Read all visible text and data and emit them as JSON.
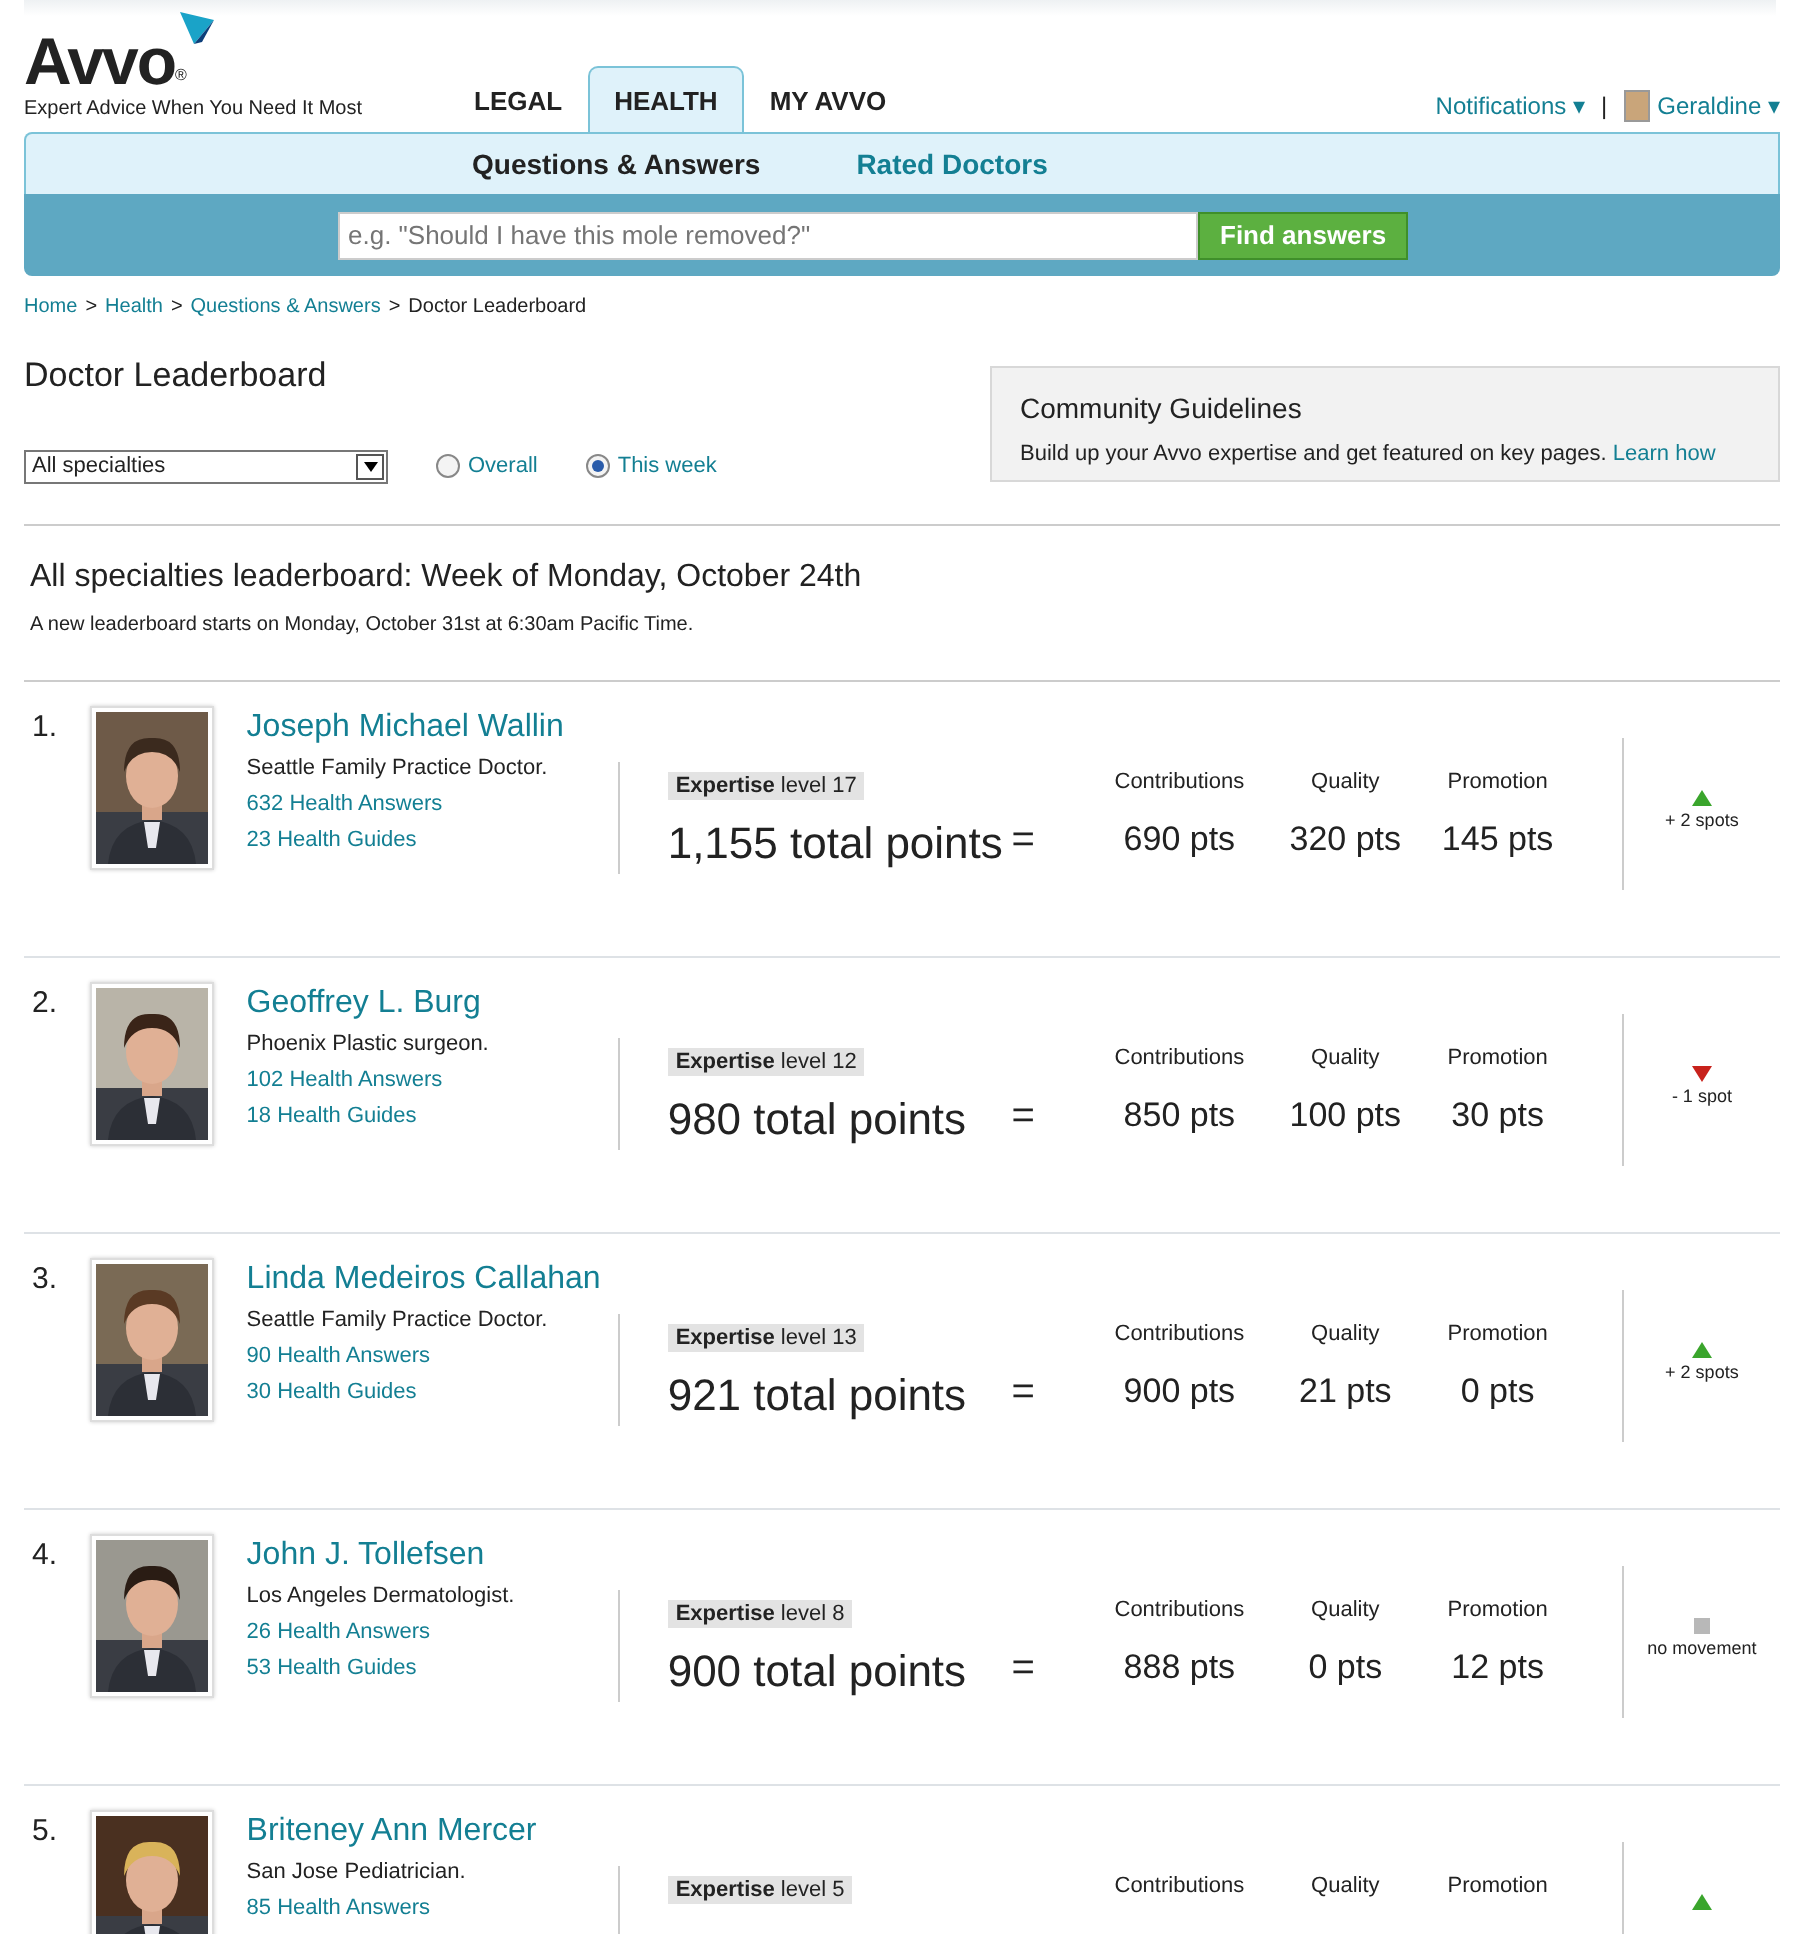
{
  "header": {
    "logo": "Avvo",
    "logo_mark": "®",
    "tagline": "Expert Advice When You Need It Most",
    "tabs": [
      {
        "label": "LEGAL",
        "selected": false
      },
      {
        "label": "HEALTH",
        "selected": true
      },
      {
        "label": "MY AVVO",
        "selected": false
      }
    ],
    "notifications": "Notifications ▾",
    "separator": "|",
    "user": "Geraldine ▾"
  },
  "subnav": [
    {
      "label": "Questions & Answers",
      "selected": true
    },
    {
      "label": "Rated Doctors",
      "selected": false
    }
  ],
  "search": {
    "placeholder": "e.g. \"Should I have this mole removed?\"",
    "button": "Find answers"
  },
  "breadcrumb": [
    {
      "label": "Home",
      "kind": "link"
    },
    {
      "label": "Health",
      "kind": "link"
    },
    {
      "label": "Questions & Answers",
      "kind": "link"
    },
    {
      "label": "Doctor Leaderboard",
      "kind": "current"
    }
  ],
  "breadcrumb_separators": [
    ">",
    ">",
    ">"
  ],
  "title": "Doctor Leaderboard",
  "filter": {
    "value": "All specialties",
    "options": [
      {
        "label": "Overall",
        "selected": false
      },
      {
        "label": "This week",
        "selected": true
      }
    ]
  },
  "guidelines": {
    "title": "Community Guidelines",
    "text": "Build up your Avvo expertise and get featured on key pages.",
    "link": "Learn how"
  },
  "board": {
    "title": "All specialties leaderboard: Week of Monday, October 24th",
    "note": "A new leaderboard starts on Monday, October 31st at 6:30am Pacific Time."
  },
  "doctors": [
    {
      "rank": "1.",
      "name": "Joseph Michael Wallin",
      "specialty": "Seattle Family Practice Doctor.",
      "answers": "632 Health Answers",
      "guides": "23 Health Guides",
      "expertise": "Expertise",
      "level": "level 17",
      "total": "1,155 total points",
      "equals": "=",
      "scores": [
        {
          "label": "Contributions",
          "value": "690 pts"
        },
        {
          "label": "Quality",
          "value": "320 pts"
        },
        {
          "label": "Promotion",
          "value": "145 pts"
        }
      ],
      "movement": {
        "kind": "up",
        "text": "+ 2 spots"
      }
    },
    {
      "rank": "2.",
      "name": "Geoffrey L. Burg",
      "specialty": "Phoenix Plastic surgeon.",
      "answers": "102 Health Answers",
      "guides": "18 Health Guides",
      "expertise": "Expertise",
      "level": "level 12",
      "total": "980 total points",
      "equals": "=",
      "scores": [
        {
          "label": "Contributions",
          "value": "850 pts"
        },
        {
          "label": "Quality",
          "value": "100 pts"
        },
        {
          "label": "Promotion",
          "value": "30 pts"
        }
      ],
      "movement": {
        "kind": "down",
        "text": "- 1 spot"
      }
    },
    {
      "rank": "3.",
      "name": "Linda Medeiros Callahan",
      "specialty": "Seattle Family Practice Doctor.",
      "answers": "90 Health Answers",
      "guides": "30 Health Guides",
      "expertise": "Expertise",
      "level": "level 13",
      "total": "921 total points",
      "equals": "=",
      "scores": [
        {
          "label": "Contributions",
          "value": "900 pts"
        },
        {
          "label": "Quality",
          "value": "21 pts"
        },
        {
          "label": "Promotion",
          "value": "0 pts"
        }
      ],
      "movement": {
        "kind": "up",
        "text": "+ 2 spots"
      }
    },
    {
      "rank": "4.",
      "name": "John J. Tollefsen",
      "specialty": "Los Angeles Dermatologist.",
      "answers": "26 Health Answers",
      "guides": "53 Health Guides",
      "expertise": "Expertise",
      "level": "level 8",
      "total": "900 total points",
      "equals": "=",
      "scores": [
        {
          "label": "Contributions",
          "value": "888 pts"
        },
        {
          "label": "Quality",
          "value": "0 pts"
        },
        {
          "label": "Promotion",
          "value": "12 pts"
        }
      ],
      "movement": {
        "kind": "none",
        "text": "no movement"
      }
    },
    {
      "rank": "5.",
      "name": "Briteney Ann Mercer",
      "specialty": "San Jose Pediatrician.",
      "answers": "85 Health Answers",
      "expertise": "Expertise",
      "level": "level 5",
      "scores": [
        {
          "label": "Contributions"
        },
        {
          "label": "Quality"
        },
        {
          "label": "Promotion"
        }
      ],
      "movement": {
        "kind": "up"
      }
    }
  ]
}
